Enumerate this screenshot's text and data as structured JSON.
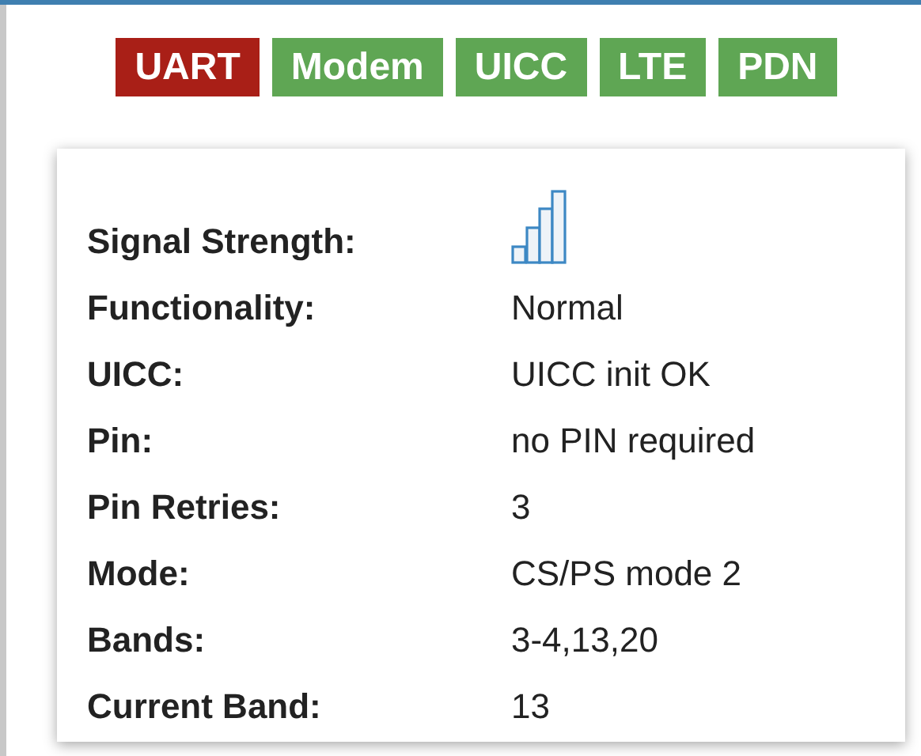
{
  "badges": [
    {
      "label": "UART",
      "color": "#a91f17"
    },
    {
      "label": "Modem",
      "color": "#5fa654"
    },
    {
      "label": "UICC",
      "color": "#5fa654"
    },
    {
      "label": "LTE",
      "color": "#5fa654"
    },
    {
      "label": "PDN",
      "color": "#5fa654"
    }
  ],
  "details": [
    {
      "label": "Signal Strength:",
      "kind": "signal"
    },
    {
      "label": "Functionality:",
      "kind": "text",
      "value": "Normal"
    },
    {
      "label": "UICC:",
      "kind": "text",
      "value": "UICC init OK"
    },
    {
      "label": "Pin:",
      "kind": "text",
      "value": "no PIN required"
    },
    {
      "label": "Pin Retries:",
      "kind": "text",
      "value": "3"
    },
    {
      "label": "Mode:",
      "kind": "text",
      "value": "CS/PS mode 2"
    },
    {
      "label": "Bands:",
      "kind": "text",
      "value": "3-4,13,20"
    },
    {
      "label": "Current Band:",
      "kind": "text",
      "value": "13"
    }
  ]
}
